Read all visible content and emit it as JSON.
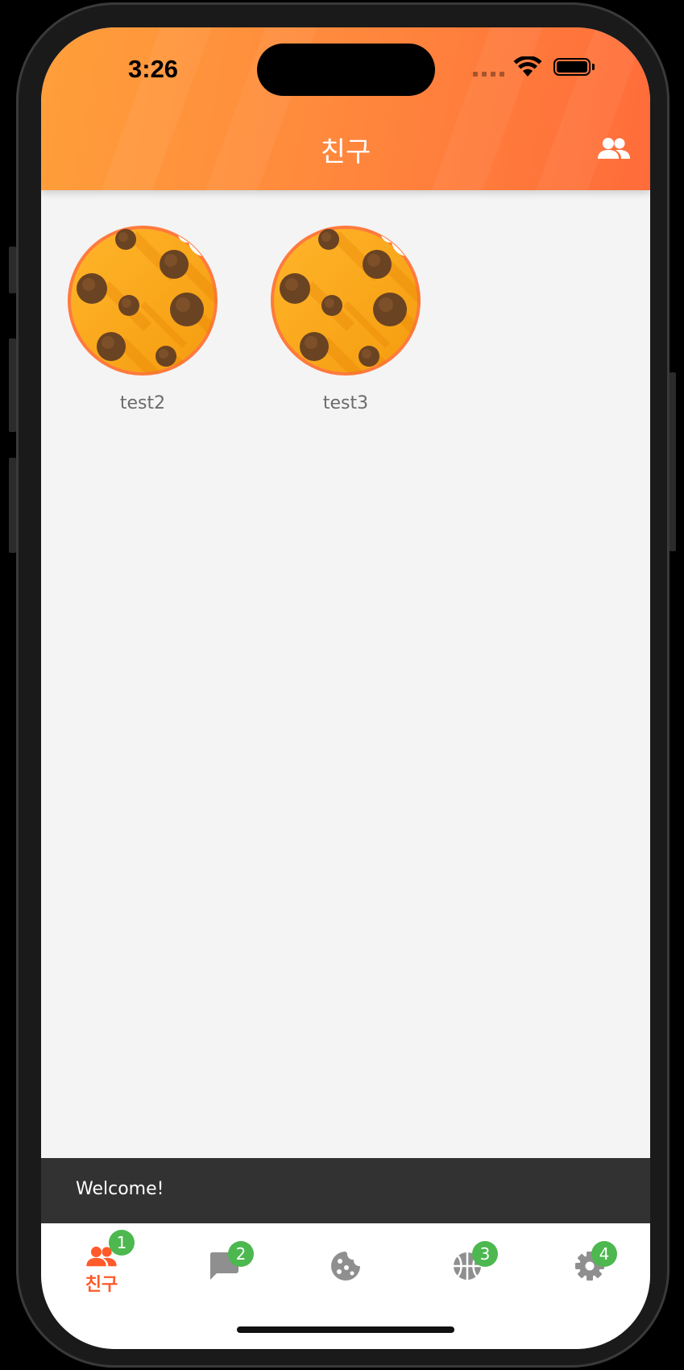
{
  "status_bar": {
    "time": "3:26"
  },
  "header": {
    "title": "친구",
    "action_icon": "people-icon",
    "gradient_start": "#ff9f3a",
    "gradient_end": "#ff6c3a"
  },
  "friends": [
    {
      "name": "test2",
      "avatar_icon": "cookie-avatar"
    },
    {
      "name": "test3",
      "avatar_icon": "cookie-avatar"
    }
  ],
  "snackbar": {
    "message": "Welcome!"
  },
  "tabbar": {
    "active_color": "#ff5a2a",
    "inactive_color": "#8f8f8f",
    "badge_color": "#4cb84f",
    "tabs": [
      {
        "icon": "people-icon",
        "label": "친구",
        "badge": "1",
        "active": true
      },
      {
        "icon": "chat-icon",
        "label": "",
        "badge": "2",
        "active": false
      },
      {
        "icon": "cookie-icon",
        "label": "",
        "badge": "",
        "active": false
      },
      {
        "icon": "basketball-icon",
        "label": "",
        "badge": "3",
        "active": false
      },
      {
        "icon": "gear-icon",
        "label": "",
        "badge": "4",
        "active": false
      }
    ]
  }
}
